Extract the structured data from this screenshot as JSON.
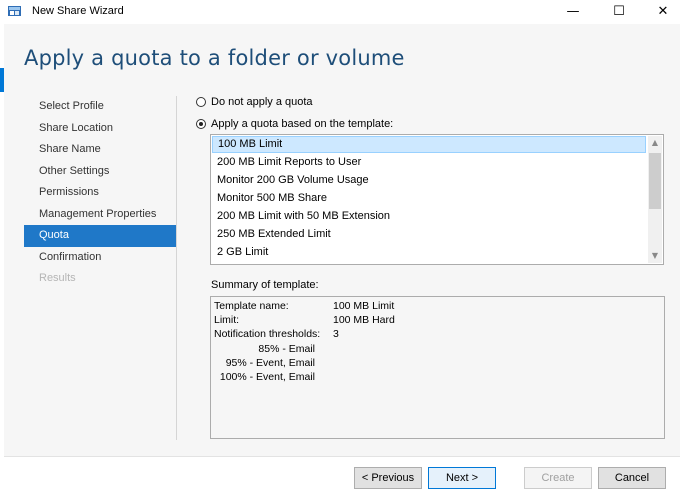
{
  "window": {
    "title": "New Share Wizard",
    "minimize": "—",
    "maximize": "☐",
    "close": "✕"
  },
  "header": {
    "title": "Apply a quota to a folder or volume"
  },
  "sidebar": {
    "items": [
      {
        "label": "Select Profile",
        "state": "normal"
      },
      {
        "label": "Share Location",
        "state": "normal"
      },
      {
        "label": "Share Name",
        "state": "normal"
      },
      {
        "label": "Other Settings",
        "state": "normal"
      },
      {
        "label": "Permissions",
        "state": "normal"
      },
      {
        "label": "Management Properties",
        "state": "normal"
      },
      {
        "label": "Quota",
        "state": "active"
      },
      {
        "label": "Confirmation",
        "state": "normal"
      },
      {
        "label": "Results",
        "state": "disabled"
      }
    ]
  },
  "quota": {
    "option_none": "Do not apply a quota",
    "option_template": "Apply a quota based on the template:",
    "selected_option": "template",
    "templates": [
      "100 MB Limit",
      "200 MB Limit Reports to User",
      "Monitor 200 GB Volume Usage",
      "Monitor 500 MB Share",
      "200 MB Limit with 50 MB Extension",
      "250 MB Extended Limit",
      "2 GB Limit"
    ],
    "selected_template": "100 MB Limit"
  },
  "summary": {
    "label": "Summary of template:",
    "template_name_key": "Template name:",
    "template_name_value": "100 MB Limit",
    "limit_key": "Limit:",
    "limit_value": "100 MB Hard",
    "thresholds_key": "Notification thresholds:",
    "thresholds_value": "3",
    "thresholds": [
      "85% - Email",
      "95% - Event, Email",
      "100% - Event, Email"
    ]
  },
  "buttons": {
    "previous": "< Previous",
    "next": "Next >",
    "create": "Create",
    "cancel": "Cancel"
  },
  "colors": {
    "accent": "#0078d7",
    "nav_active": "#1f78c8",
    "title": "#1e4e79",
    "selection": "#cde8ff"
  }
}
